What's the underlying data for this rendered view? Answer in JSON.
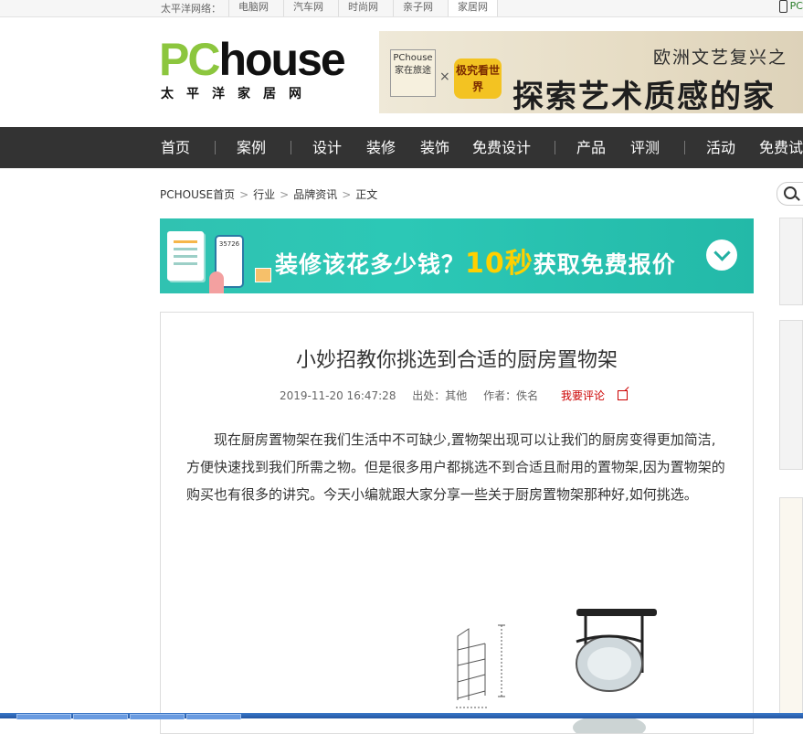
{
  "topbar": {
    "label": "太平洋网络：",
    "sites": [
      "电脑网",
      "汽车网",
      "时尚网",
      "亲子网",
      "家居网"
    ],
    "active_site": "家居网",
    "phone_text": "PC"
  },
  "logo": {
    "text_green": "PC",
    "text_black": "house",
    "subtitle": "太平洋家居网"
  },
  "top_banner": {
    "brand_box": "PChouse 家在旅途",
    "cross": "×",
    "badge": "极究看世界",
    "headline_small": "欧洲文艺复兴之",
    "headline_large": "探索艺术质感的家"
  },
  "nav": {
    "items": [
      "首页",
      "案例",
      "设计",
      "装修",
      "装饰",
      "免费设计",
      "产品",
      "评测",
      "活动",
      "免费试"
    ]
  },
  "breadcrumb": {
    "items": [
      "PCHOUSE首页",
      "行业",
      "品牌资讯",
      "正文"
    ],
    "separator": ">"
  },
  "ad": {
    "text_pre": "装修该花多少钱？",
    "text_highlight": "10秒",
    "text_post": "获取免费报价",
    "phone_number": "35726"
  },
  "article": {
    "title": "小妙招教你挑选到合适的厨房置物架",
    "datetime": "2019-11-20 16:47:28",
    "source": "出处：其他",
    "author": "作者：佚名",
    "comment_link": "我要评论",
    "body": "现在厨房置物架在我们生活中不可缺少,置物架出现可以让我们的厨房变得更加简洁,方便快速找到我们所需之物。但是很多用户都挑选不到合适且耐用的置物架,因为置物架的购买也有很多的讲究。今天小编就跟大家分享一些关于厨房置物架那种好,如何挑选。"
  },
  "colors": {
    "logo_green": "#8cc63e",
    "nav_bg": "#333333",
    "ad_teal": "#2cc8b6",
    "ad_highlight": "#ffd000",
    "comment_red": "#cc0000"
  },
  "icons": [
    "phone-icon",
    "search-icon",
    "chevron-down-icon",
    "external-link-icon"
  ]
}
